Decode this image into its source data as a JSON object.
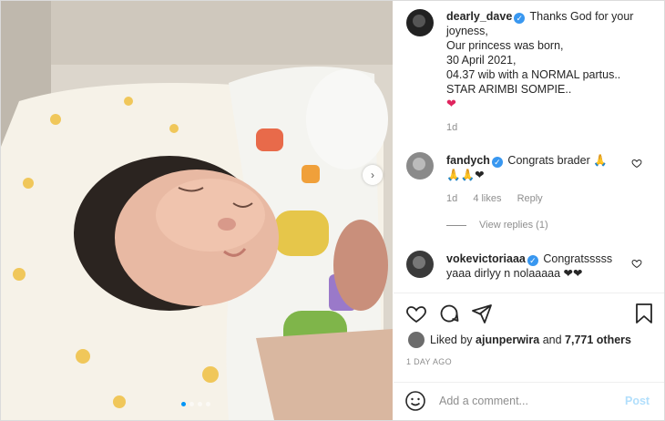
{
  "post": {
    "author": "dearly_dave",
    "caption_lines": [
      "Thanks God for your",
      "joyness,",
      "Our princess was born,",
      "30 April 2021,",
      "04.37 wib with a NORMAL partus..",
      "STAR ARIMBI SOMPIE.."
    ],
    "caption_heart": "❤",
    "caption_time": "1d"
  },
  "comments": [
    {
      "user": "fandych",
      "text": "Congrats brader 🙏",
      "text_line2": "🙏🙏❤",
      "time": "1d",
      "likes": "4 likes",
      "reply": "Reply"
    },
    {
      "user": "vokevictoriaaa",
      "text": "Congratsssss",
      "text_line2": "yaaa dirlyy n nolaaaaa ❤❤"
    }
  ],
  "view_replies": "View replies (1)",
  "likes_summary": {
    "prefix": "Liked by",
    "user": "ajunperwira",
    "middle": "and",
    "others": "7,771 others"
  },
  "time_ago": "1 DAY AGO",
  "comment_box": {
    "placeholder": "Add a comment...",
    "post_label": "Post"
  },
  "icons": {
    "like": "heart-outline-icon",
    "comment": "comment-icon",
    "share": "paper-plane-icon",
    "save": "bookmark-icon",
    "emoji": "smiley-icon",
    "next": "chevron-right-icon"
  },
  "colors": {
    "verified": "#3897f0",
    "heart": "#e0245e",
    "post_button": "#b2dffc",
    "active_dot": "#0095f6"
  },
  "carousel": {
    "slides": 4,
    "current": 1
  }
}
